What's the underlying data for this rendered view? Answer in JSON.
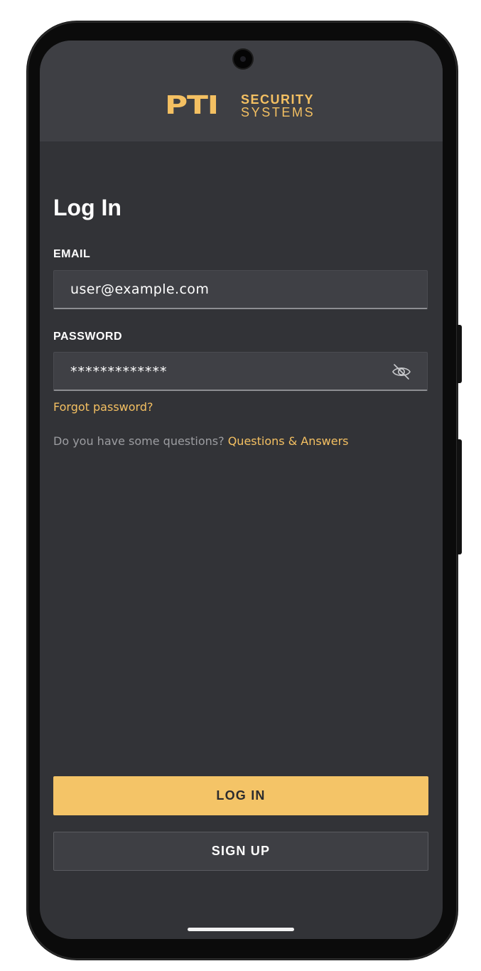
{
  "branding": {
    "logo_mark": "PTI",
    "logo_word_top": "SECURITY",
    "logo_word_bottom": "SYSTEMS",
    "accent_color": "#f4c062"
  },
  "login": {
    "title": "Log In",
    "email_label": "EMAIL",
    "email_value": "user@example.com",
    "password_label": "PASSWORD",
    "password_value": "*************",
    "password_toggle_icon": "eye-off-icon",
    "forgot_password": "Forgot password?",
    "questions_prompt": "Do you have some questions?",
    "questions_link": "Questions & Answers"
  },
  "actions": {
    "login_label": "LOG IN",
    "signup_label": "SIGN UP"
  },
  "colors": {
    "background": "#323337",
    "header_background": "#3e3f44",
    "primary_button": "#f4c467"
  }
}
